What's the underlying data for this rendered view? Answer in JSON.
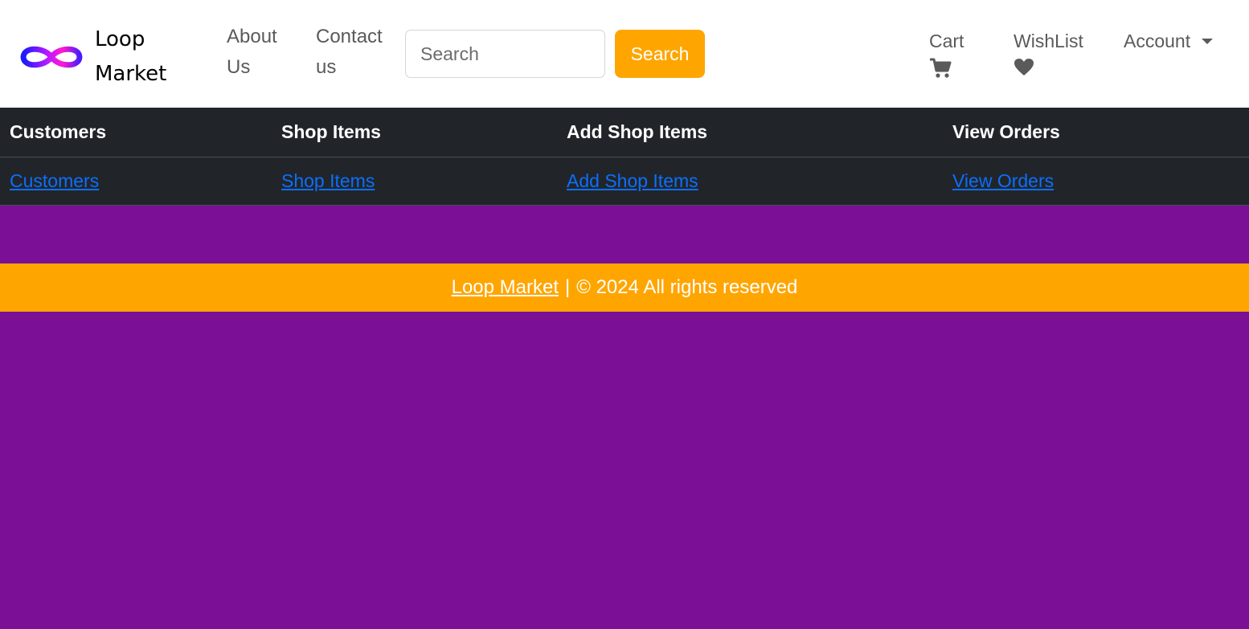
{
  "brand": {
    "line1": "Loop",
    "line2": "Market",
    "logo_icon": "infinity-logo-icon"
  },
  "nav": {
    "about_line1": "About",
    "about_line2": "Us",
    "contact_line1": "Contact",
    "contact_line2": "us",
    "search_placeholder": "Search",
    "search_button": "Search",
    "cart_label": "Cart",
    "cart_icon": "cart-icon",
    "wishlist_label": "WishList",
    "wishlist_icon": "heart-icon",
    "account_label": "Account"
  },
  "admin_table": {
    "headers": [
      "Customers",
      "Shop Items",
      "Add Shop Items",
      "View Orders"
    ],
    "links": [
      "Customers",
      "Shop Items",
      "Add Shop Items",
      "View Orders"
    ]
  },
  "footer": {
    "brand_link": "Loop Market",
    "separator": "|",
    "copyright": "© 2024 All rights reserved"
  },
  "colors": {
    "page_background": "#7b0f95",
    "accent": "#ffa500",
    "table_background": "#212529",
    "link": "#0d6efd"
  }
}
